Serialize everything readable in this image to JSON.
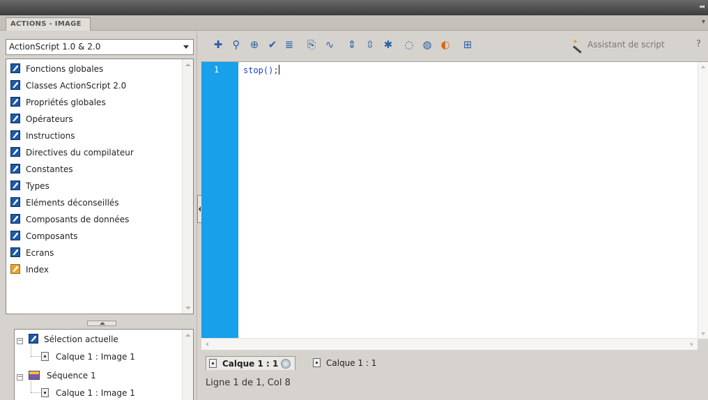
{
  "panel": {
    "tab_label": "ACTIONS - IMAGE"
  },
  "version_select": {
    "value": "ActionScript 1.0 & 2.0"
  },
  "toolbox": {
    "items": [
      {
        "label": "Fonctions globales",
        "icon": "book-icon"
      },
      {
        "label": "Classes ActionScript 2.0",
        "icon": "book-icon"
      },
      {
        "label": "Propriétés globales",
        "icon": "book-icon"
      },
      {
        "label": "Opérateurs",
        "icon": "book-icon"
      },
      {
        "label": "Instructions",
        "icon": "book-icon"
      },
      {
        "label": "Directives du compilateur",
        "icon": "book-icon"
      },
      {
        "label": "Constantes",
        "icon": "book-icon"
      },
      {
        "label": "Types",
        "icon": "book-icon"
      },
      {
        "label": "Eléments déconseillés",
        "icon": "book-icon"
      },
      {
        "label": "Composants de données",
        "icon": "book-icon"
      },
      {
        "label": "Composants",
        "icon": "book-icon"
      },
      {
        "label": "Ecrans",
        "icon": "book-icon"
      },
      {
        "label": "Index",
        "icon": "index-book-icon"
      }
    ]
  },
  "script_navigator": {
    "current_selection": "Sélection actuelle",
    "current_frame": "Calque 1 : Image 1",
    "scene": "Séquence 1",
    "scene_frame": "Calque 1 : Image 1"
  },
  "toolbar": {
    "buttons": [
      "add-item-icon",
      "find-icon",
      "insert-target-path-icon",
      "check-syntax-icon",
      "auto-format-icon",
      "show-code-hint-icon",
      "debug-options-icon",
      "collapse-between-braces-icon",
      "collapse-selection-icon",
      "expand-all-icon",
      "apply-block-comment-icon",
      "apply-line-comment-icon",
      "remove-comment-icon",
      "show-hide-toolbox-icon"
    ],
    "script_assist_label": "Assistant de script",
    "help_glyph": "?"
  },
  "editor": {
    "line_number": "1",
    "code": "stop();",
    "accent_color": "#18a0ea"
  },
  "script_tabs": {
    "active": "Calque 1 : 1",
    "other": "Calque 1 : 1"
  },
  "status": {
    "position": "Ligne 1 de 1, Col 8"
  }
}
